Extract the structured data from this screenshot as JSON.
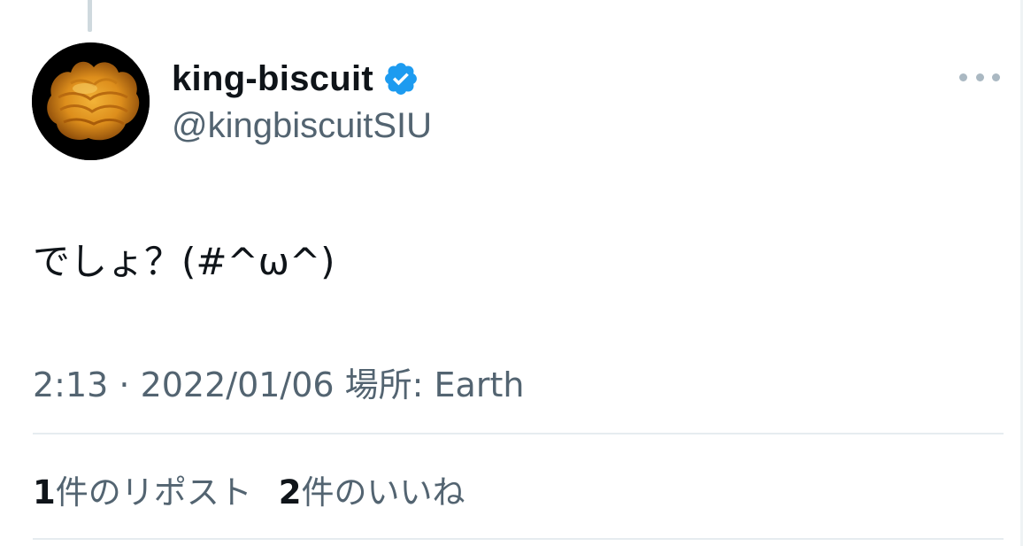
{
  "author": {
    "display_name": "king-biscuit",
    "handle": "@kingbiscuitSIU",
    "verified": true,
    "avatar_icon": "biscuit-photo"
  },
  "tweet": {
    "text": "でしょ？(#^ω^)"
  },
  "meta": {
    "text": "2:13 · 2022/01/06 場所: Earth"
  },
  "stats": {
    "reposts_count": "1",
    "reposts_label": "件のリポスト",
    "likes_count": "2",
    "likes_label": "件のいいね"
  },
  "colors": {
    "text_primary": "#0f1419",
    "text_secondary": "#536471",
    "verified_blue": "#1d9bf0",
    "divider": "#e6ecf0"
  }
}
